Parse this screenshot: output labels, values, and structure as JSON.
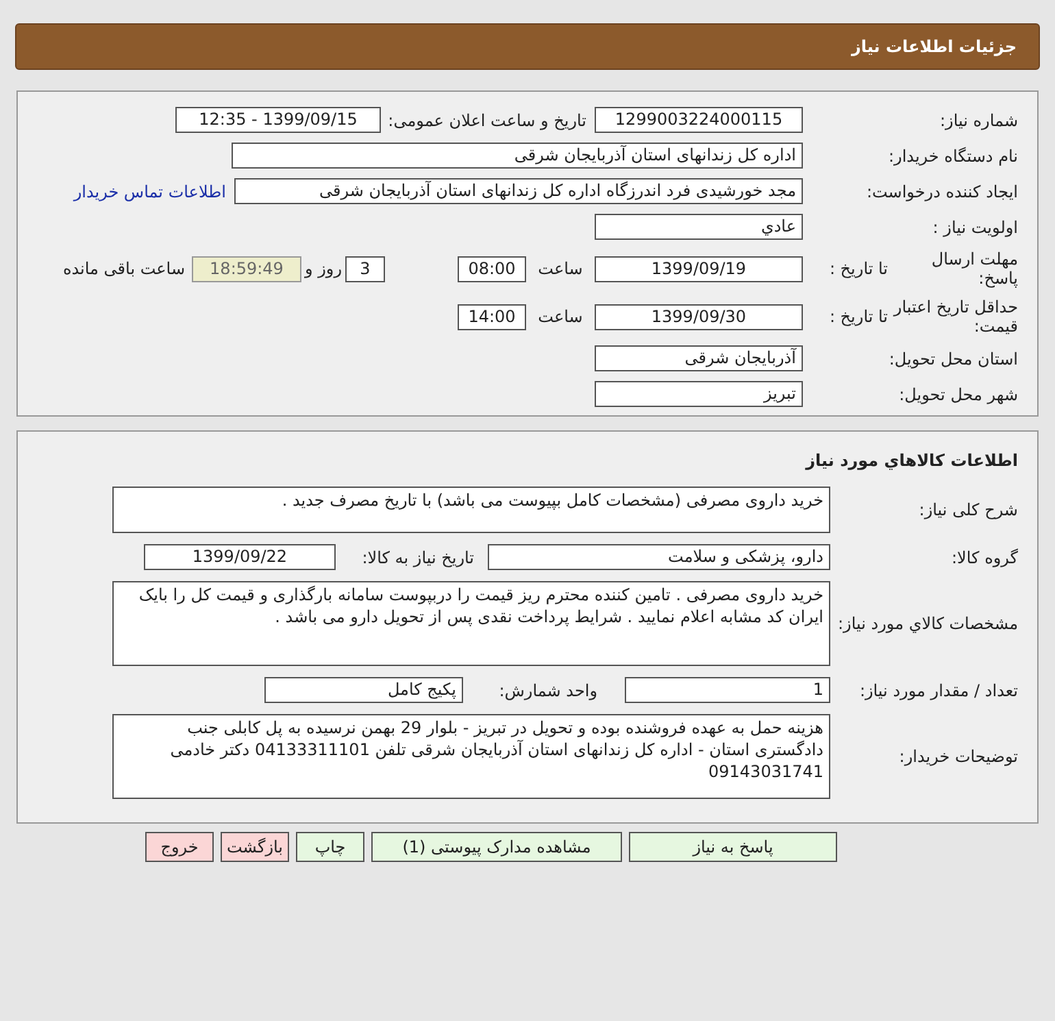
{
  "header": {
    "title": "جزئیات اطلاعات نیاز"
  },
  "need_info": {
    "need_number": {
      "label": "شماره نیاز:",
      "value": "1299003224000115"
    },
    "announce": {
      "label": "تاریخ و ساعت اعلان عمومی:",
      "value": "1399/09/15 - 12:35"
    },
    "buyer_org": {
      "label": "نام دستگاه خریدار:",
      "value": "اداره کل زندانهای استان آذربایجان شرقی"
    },
    "requester": {
      "label": "ایجاد کننده درخواست:",
      "value": "مجد خورشیدی فرد اندرزگاه اداره کل زندانهای استان آذربایجان شرقی",
      "link": "اطلاعات تماس خریدار"
    },
    "priority": {
      "label": "اولویت نیاز :",
      "value": "عادي"
    },
    "reply_deadline": {
      "label": "مهلت ارسال پاسخ:",
      "to_date_label": "تا تاریخ :",
      "date": "1399/09/19",
      "time_label": "ساعت",
      "time": "08:00",
      "days": "3",
      "days_label": "روز و",
      "remaining": "18:59:49",
      "remaining_label": "ساعت باقی مانده"
    },
    "price_validity": {
      "label": "حداقل تاریخ اعتبار قیمت:",
      "to_date_label": "تا تاریخ :",
      "date": "1399/09/30",
      "time_label": "ساعت",
      "time": "14:00"
    },
    "province": {
      "label": "استان محل تحویل:",
      "value": "آذربایجان شرقی"
    },
    "city": {
      "label": "شهر محل تحویل:",
      "value": "تبریز"
    }
  },
  "goods": {
    "title": "اطلاعات کالاهاي مورد نیاز",
    "description": {
      "label": "شرح کلی نیاز:",
      "value": "خرید داروی مصرفی (مشخصات کامل بپیوست می باشد) با تاریخ مصرف جدید ."
    },
    "group": {
      "label": "گروه کالا:",
      "value": "دارو، پزشکی و سلامت"
    },
    "need_date": {
      "label": "تاریخ نیاز به کالا:",
      "value": "1399/09/22"
    },
    "specs": {
      "label": "مشخصات کالاي مورد نیاز:",
      "value": "خرید داروی مصرفی . تامین کننده محترم ریز قیمت را دربپوست سامانه بارگذاری و قیمت کل را بایک ایران کد مشابه اعلام نمایید . شرایط پرداخت نقدی پس از تحویل دارو می باشد ."
    },
    "quantity": {
      "label": "تعداد / مقدار مورد نیاز:",
      "value": "1"
    },
    "unit": {
      "label": "واحد شمارش:",
      "value": "پکیج کامل"
    },
    "buyer_notes": {
      "label": "توضیحات خریدار:",
      "value": "هزینه حمل به عهده فروشنده بوده و تحویل در تبریز - بلوار 29 بهمن نرسیده به پل کابلی جنب دادگستری استان - اداره کل زندانهای استان آذربایجان شرقی تلفن 04133311101 دکتر خادمی 09143031741"
    }
  },
  "buttons": [
    {
      "label": "پاسخ به نیاز",
      "kind": "action"
    },
    {
      "label": "مشاهده مدارک پیوستی (1)",
      "kind": "action"
    },
    {
      "label": "چاپ",
      "kind": "action"
    },
    {
      "label": "بازگشت",
      "kind": "exit"
    },
    {
      "label": "خروج",
      "kind": "exit"
    }
  ]
}
